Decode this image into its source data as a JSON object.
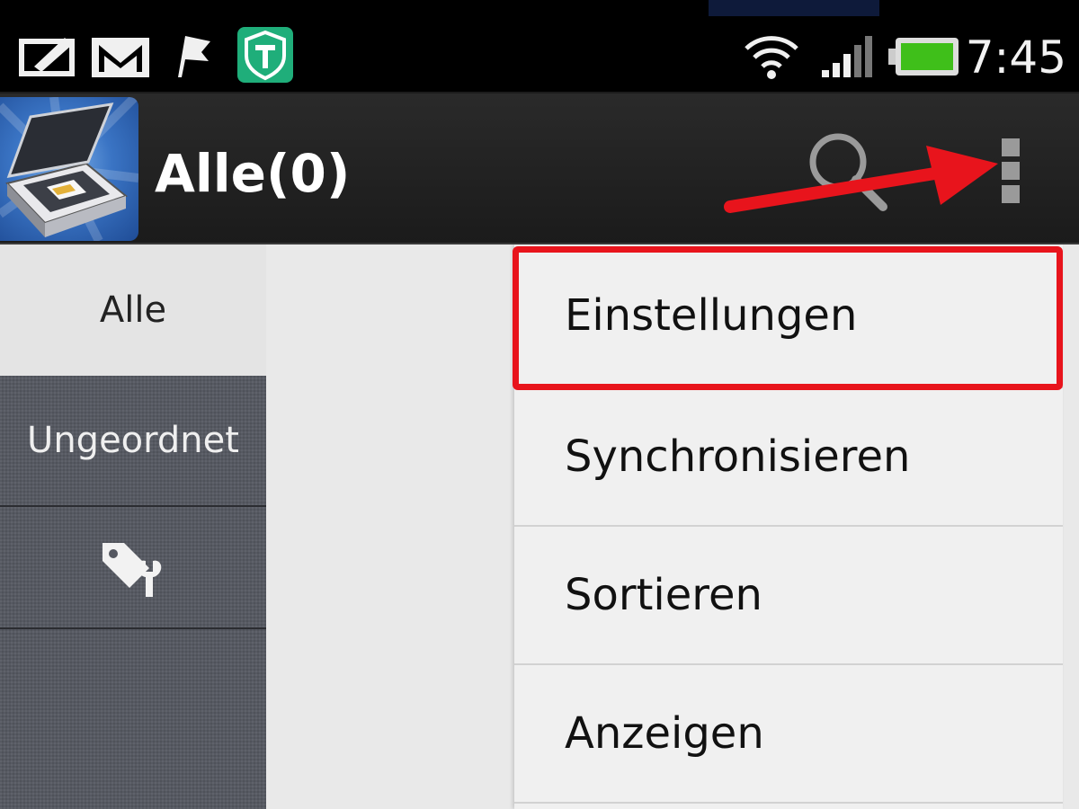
{
  "status_bar": {
    "time": "7:45",
    "icons": [
      "compose-icon",
      "gmail-icon",
      "flag-icon",
      "app-t-shield-icon",
      "wifi-icon",
      "signal-icon",
      "battery-icon"
    ],
    "battery_color": "#3fbf1a"
  },
  "action_bar": {
    "title": "Alle(0)",
    "app_icon": "scanner-app-icon",
    "actions": [
      "search-icon",
      "overflow-menu-icon"
    ]
  },
  "sidebar": {
    "items": [
      {
        "label": "Alle",
        "active": true
      },
      {
        "label": "Ungeordnet",
        "active": false
      },
      {
        "label": "",
        "icon": "tag-wrench-icon",
        "active": false
      }
    ]
  },
  "overflow_menu": {
    "items": [
      {
        "label": "Einstellungen",
        "highlighted": true
      },
      {
        "label": "Synchronisieren"
      },
      {
        "label": "Sortieren"
      },
      {
        "label": "Anzeigen"
      }
    ]
  },
  "annotations": {
    "highlight_color": "#e8141c",
    "arrow_color": "#e8141c"
  }
}
